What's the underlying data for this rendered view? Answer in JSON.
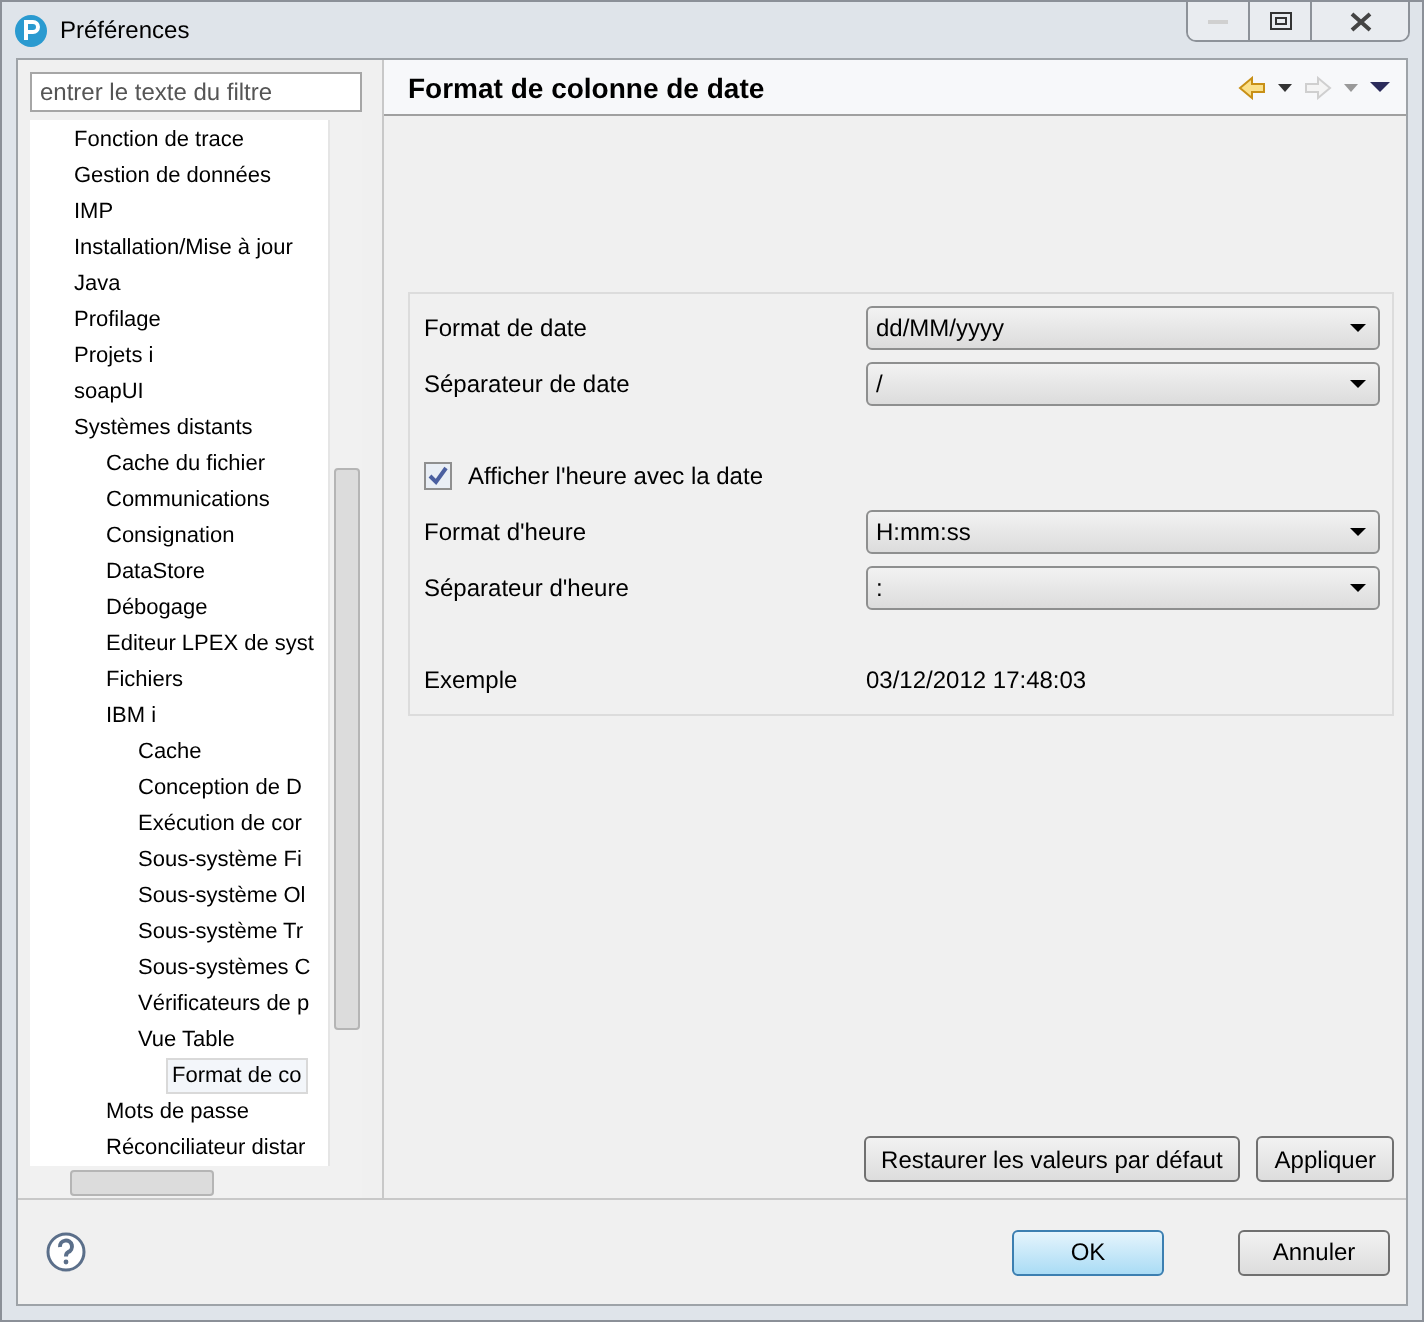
{
  "window": {
    "title": "Préférences"
  },
  "filter": {
    "placeholder": "entrer le texte du filtre"
  },
  "tree": [
    {
      "label": "Fonction de trace",
      "selected": false
    },
    {
      "label": "Gestion de données",
      "selected": false
    },
    {
      "label": "IMP",
      "selected": false
    },
    {
      "label": "Installation/Mise à jour",
      "selected": false
    },
    {
      "label": "Java",
      "selected": false
    },
    {
      "label": "Profilage",
      "selected": false
    },
    {
      "label": "Projets i",
      "selected": false
    },
    {
      "label": "soapUI",
      "selected": false
    },
    {
      "label": "Systèmes distants",
      "selected": false,
      "children": [
        {
          "label": "Cache du fichier",
          "selected": false
        },
        {
          "label": "Communications",
          "selected": false
        },
        {
          "label": "Consignation",
          "selected": false
        },
        {
          "label": "DataStore",
          "selected": false
        },
        {
          "label": "Débogage",
          "selected": false
        },
        {
          "label": "Editeur LPEX de syst",
          "selected": false
        },
        {
          "label": "Fichiers",
          "selected": false
        },
        {
          "label": "IBM i",
          "selected": false,
          "children": [
            {
              "label": "Cache",
              "selected": false
            },
            {
              "label": "Conception de D",
              "selected": false
            },
            {
              "label": "Exécution de cor",
              "selected": false
            },
            {
              "label": "Sous-système Fi",
              "selected": false
            },
            {
              "label": "Sous-système Ol",
              "selected": false
            },
            {
              "label": "Sous-système Tr",
              "selected": false
            },
            {
              "label": "Sous-systèmes C",
              "selected": false
            },
            {
              "label": "Vérificateurs de p",
              "selected": false
            },
            {
              "label": "Vue Table",
              "selected": false,
              "children": [
                {
                  "label": "Format de co",
                  "selected": true
                }
              ]
            }
          ]
        },
        {
          "label": "Mots de passe",
          "selected": false
        },
        {
          "label": "Réconciliateur distar",
          "selected": false
        }
      ]
    }
  ],
  "page": {
    "title": "Format de colonne de date"
  },
  "form": [
    {
      "kind": "select",
      "label": "Format de date",
      "value": "dd/MM/yyyy"
    },
    {
      "kind": "select",
      "label": "Séparateur de date",
      "value": "/"
    },
    {
      "kind": "checkbox",
      "label": "Afficher l'heure avec la date",
      "checked": true
    },
    {
      "kind": "select",
      "label": "Format d'heure",
      "value": "H:mm:ss"
    },
    {
      "kind": "select",
      "label": "Séparateur d'heure",
      "value": ":"
    },
    {
      "kind": "readout",
      "label": "Exemple",
      "value": "03/12/2012 17:48:03"
    }
  ],
  "page_buttons": [
    "Restaurer les valeurs par défaut",
    "Appliquer"
  ],
  "dialog_buttons": [
    {
      "label": "OK",
      "default": true
    },
    {
      "label": "Annuler",
      "default": false
    }
  ]
}
